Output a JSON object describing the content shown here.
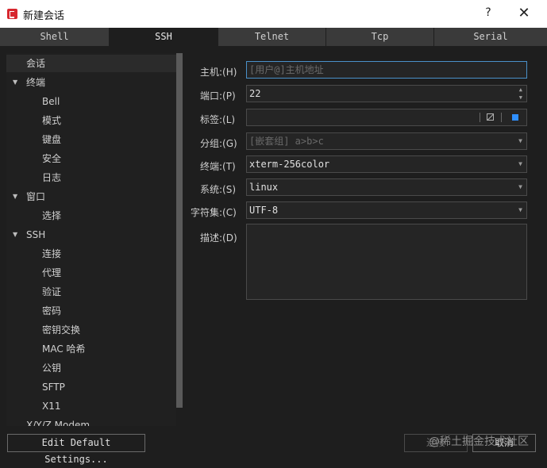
{
  "window": {
    "title": "新建会话",
    "help": "?",
    "close": "✕"
  },
  "tabs": [
    {
      "label": "Shell",
      "active": false
    },
    {
      "label": "SSH",
      "active": true
    },
    {
      "label": "Telnet",
      "active": false
    },
    {
      "label": "Tcp",
      "active": false
    },
    {
      "label": "Serial",
      "active": false
    }
  ],
  "tree": [
    {
      "label": "会话",
      "level": 0,
      "selected": true,
      "expandable": false
    },
    {
      "label": "终端",
      "level": 0,
      "expandable": true
    },
    {
      "label": "Bell",
      "level": 1
    },
    {
      "label": "模式",
      "level": 1
    },
    {
      "label": "键盘",
      "level": 1
    },
    {
      "label": "安全",
      "level": 1
    },
    {
      "label": "日志",
      "level": 1
    },
    {
      "label": "窗口",
      "level": 0,
      "expandable": true
    },
    {
      "label": "选择",
      "level": 1
    },
    {
      "label": "SSH",
      "level": 0,
      "expandable": true
    },
    {
      "label": "连接",
      "level": 1
    },
    {
      "label": "代理",
      "level": 1
    },
    {
      "label": "验证",
      "level": 1
    },
    {
      "label": "密码",
      "level": 1
    },
    {
      "label": "密钥交换",
      "level": 1
    },
    {
      "label": "MAC 哈希",
      "level": 1
    },
    {
      "label": "公钥",
      "level": 1
    },
    {
      "label": "SFTP",
      "level": 1
    },
    {
      "label": "X11",
      "level": 1
    },
    {
      "label": "X/Y/Z Modem",
      "level": 0
    }
  ],
  "form": {
    "host_label": "主机:(H)",
    "host_placeholder": "[用户@]主机地址",
    "port_label": "端口:(P)",
    "port_value": "22",
    "tag_label": "标签:(L)",
    "tag_value": "",
    "group_label": "分组:(G)",
    "group_placeholder": "[嵌套组] a>b>c",
    "terminal_label": "终端:(T)",
    "terminal_value": "xterm-256color",
    "system_label": "系统:(S)",
    "system_value": "linux",
    "charset_label": "字符集:(C)",
    "charset_value": "UTF-8",
    "desc_label": "描述:(D)",
    "desc_value": ""
  },
  "buttons": {
    "edit_defaults": "Edit Default Settings...",
    "connect": "连接",
    "cancel": "取消"
  },
  "watermark": "@稀土掘金技术社区",
  "colors": {
    "accent_blue": "#4a90c8",
    "color_swatch": "#2f8fff",
    "app_icon_red": "#d7262e"
  }
}
